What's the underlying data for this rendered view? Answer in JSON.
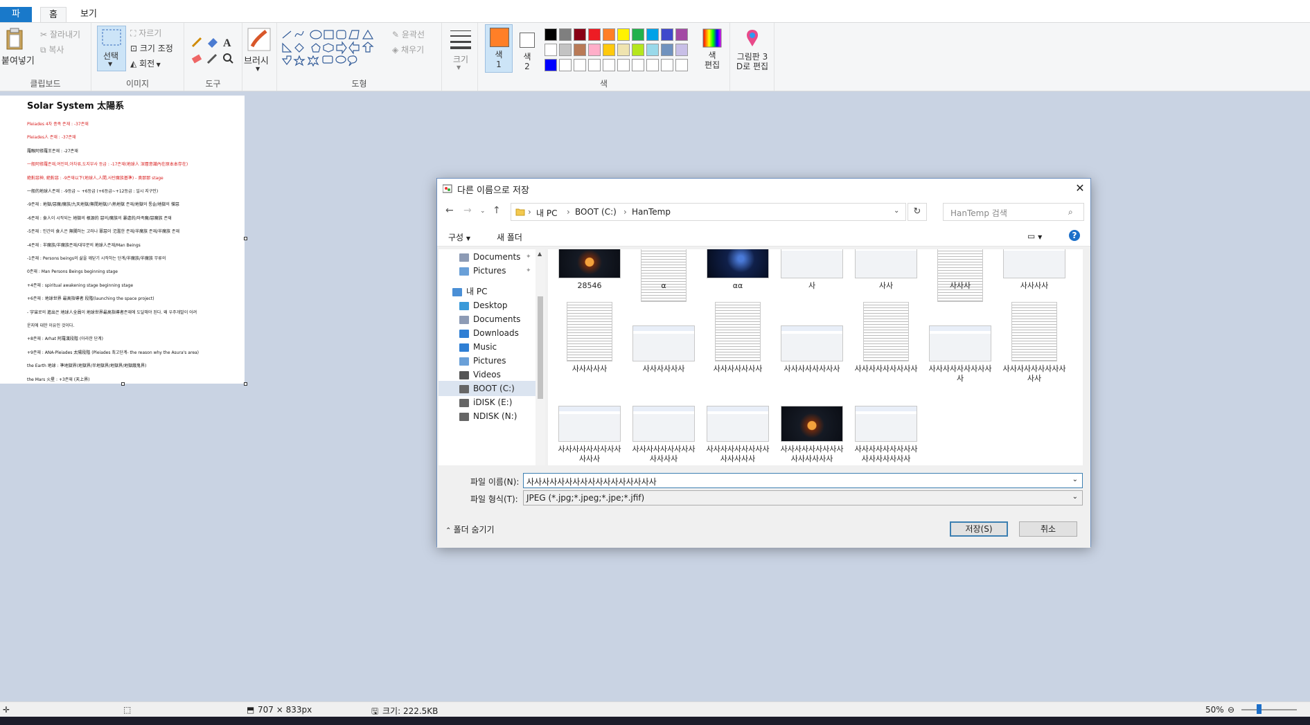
{
  "ribbon": {
    "tabs": [
      "파일",
      "홈",
      "보기"
    ],
    "clipboard": {
      "paste": "붙여넣기",
      "cut": "잘라내기",
      "copy": "복사",
      "label": "클립보드"
    },
    "image": {
      "select": "선택",
      "crop": "자르기",
      "resize": "크기 조정",
      "rotate": "회전",
      "label": "이미지"
    },
    "tools": {
      "label": "도구"
    },
    "brush": {
      "label": "브러시"
    },
    "shapes": {
      "outline": "윤곽선",
      "fill": "채우기",
      "label": "도형"
    },
    "size": {
      "label": "크기"
    },
    "colors": {
      "color1": "색\n1",
      "color2": "색\n2",
      "edit": "색\n편집",
      "label": "색",
      "palette_row1": [
        "#000000",
        "#7f7f7f",
        "#880015",
        "#ed1c24",
        "#ff7f27",
        "#fff200",
        "#22b14c",
        "#00a2e8",
        "#3f48cc",
        "#a349a4"
      ],
      "palette_row2": [
        "#ffffff",
        "#c3c3c3",
        "#b97a57",
        "#ffaec9",
        "#ffc90e",
        "#efe4b0",
        "#b5e61d",
        "#99d9ea",
        "#7092be",
        "#c8bfe7"
      ],
      "palette_row3": [
        "#0000ff",
        "#ffffff",
        "#ffffff",
        "#ffffff",
        "#ffffff",
        "#ffffff",
        "#ffffff",
        "#ffffff",
        "#ffffff",
        "#ffffff"
      ],
      "primary": "#ff7f27",
      "secondary": "#ffffff"
    },
    "paint3d": "그림판 3\nD로 편집"
  },
  "canvas_doc": {
    "title": "Solar System 太陽系",
    "lines": [
      {
        "text": "Pleiades 4차 종족 존재 : -37존재",
        "red": true
      },
      {
        "text": "Pleiades人 존재 : -37존재",
        "red": true
      },
      {
        "text": "羅睺阿修羅王존재 : -27존재",
        "red": false
      },
      {
        "text": "一般阿修羅존재,여인외,야차류,도지부사 등급 : -17존재(地球人 深層意識內在原本本存在)",
        "red": true
      },
      {
        "text": "絶對惡神, 絶對惡 : -9존재以下(地球人,人間,사탄魔族基準) - 奥那那 stage",
        "red": true
      },
      {
        "text": "一般的地球人존재 : -9등급 ~ +6등급 (+6등급~+12등급 : 일시 지구인)",
        "red": false
      },
      {
        "text": "-9존재 : 地獄/惡魔/魔族/九天地獄/無間地獄/八熱地獄 존재/地獄의 통솔/地獄의 憎惡",
        "red": false
      },
      {
        "text": "-6존재 : 食人이 시작되는 地獄의 根源的 惡의/魔族의 暴虐的/마족魔/惡魔族 존재",
        "red": false
      },
      {
        "text": "-5존재 : 인간의 食人은 無關하는 고러나 罪惡이 氾濫한 존재/半魔族 존재/半魔族 존재",
        "red": false
      },
      {
        "text": "-4존재 : 半魔族/半魔族존재/대부분의 地球人존재/Man Beings",
        "red": false
      },
      {
        "text": "-1존재 : Persons beings의 삶을 깨닫기 시작하는 단계/半魔族/半魔族 무류의",
        "red": false
      },
      {
        "text": "0존재 : Man Persons Beings beginning stage",
        "red": false
      },
      {
        "text": "+4존재 : spiritual awakening stage beginning stage",
        "red": false
      },
      {
        "text": "+6존재 : 地球世界 最高指導者 段階(launching the space project)",
        "red": false
      },
      {
        "text": "- 宇宙로의 進出은 地球人全員이 地球世界最高指導者존재에 도달해야 된다. 왜 우주개발이 어려",
        "red": false
      },
      {
        "text": "운지에 대한 이유인 것이다.",
        "red": false
      },
      {
        "text": "+8존재 : Arhat 阿羅漢段階 (아라한 단계)",
        "red": false
      },
      {
        "text": "+9존재 : ANA-Pleiades 太陽段階 (Pleiades 최고단계- the reason why the Asura's area)",
        "red": false
      },
      {
        "text": "the Earth 地球 : 準地獄界(地獄界/半地獄界/地獄界/地獄餓鬼界)",
        "red": false
      },
      {
        "text": "the Mars 火星 : +3존재 (天上界)",
        "red": false
      }
    ]
  },
  "dialog": {
    "title": "다른 이름으로 저장",
    "address": [
      "내 PC",
      "BOOT (C:)",
      "HanTemp"
    ],
    "search_placeholder": "HanTemp 검색",
    "toolbar": {
      "organize": "구성",
      "new_folder": "새 폴더"
    },
    "nav": [
      {
        "label": "Documents",
        "pinned": true,
        "indent": 2,
        "color": "#8d9bb5"
      },
      {
        "label": "Pictures",
        "pinned": true,
        "indent": 2,
        "color": "#6aa0d8"
      },
      {
        "label": "내 PC",
        "pinned": false,
        "indent": 1,
        "color": "#4a8fd6"
      },
      {
        "label": "Desktop",
        "pinned": false,
        "indent": 2,
        "color": "#3a9ad9"
      },
      {
        "label": "Documents",
        "pinned": false,
        "indent": 2,
        "color": "#8d9bb5"
      },
      {
        "label": "Downloads",
        "pinned": false,
        "indent": 2,
        "color": "#2f7fd4"
      },
      {
        "label": "Music",
        "pinned": false,
        "indent": 2,
        "color": "#2f7fd4"
      },
      {
        "label": "Pictures",
        "pinned": false,
        "indent": 2,
        "color": "#6aa0d8"
      },
      {
        "label": "Videos",
        "pinned": false,
        "indent": 2,
        "color": "#555555"
      },
      {
        "label": "BOOT (C:)",
        "pinned": false,
        "indent": 2,
        "color": "#666666",
        "selected": true
      },
      {
        "label": "iDISK (E:)",
        "pinned": false,
        "indent": 2,
        "color": "#666666"
      },
      {
        "label": "NDISK (N:)",
        "pinned": false,
        "indent": 2,
        "color": "#666666"
      }
    ],
    "files": [
      {
        "name": "28546",
        "kind": "solar"
      },
      {
        "name": "α",
        "kind": "doc"
      },
      {
        "name": "αα",
        "kind": "space"
      },
      {
        "name": "사",
        "kind": "window"
      },
      {
        "name": "사사",
        "kind": "window"
      },
      {
        "name": "사사사",
        "kind": "doc"
      },
      {
        "name": "사사사사",
        "kind": "window"
      },
      {
        "name": "사사사사사",
        "kind": "doc"
      },
      {
        "name": "사사사사사사",
        "kind": "window"
      },
      {
        "name": "사사사사사사사",
        "kind": "doc"
      },
      {
        "name": "사사사사사사사사",
        "kind": "window"
      },
      {
        "name": "사사사사사사사사사",
        "kind": "doc"
      },
      {
        "name": "사사사사사사사사사사",
        "kind": "window"
      },
      {
        "name": "사사사사사사사사사사사",
        "kind": "doc"
      },
      {
        "name": "사사사사사사사사사사사사",
        "kind": "window"
      },
      {
        "name": "사사사사사사사사사사사사사",
        "kind": "window"
      },
      {
        "name": "사사사사사사사사사사사사사사",
        "kind": "window"
      },
      {
        "name": "사사사사사사사사사사사사사사사",
        "kind": "solar"
      },
      {
        "name": "사사사사사사사사사사사사사사사사",
        "kind": "window"
      }
    ],
    "filename_label": "파일 이름(N):",
    "filename_value": "사사사사사사사사사사사사사사사사사",
    "filetype_label": "파일 형식(T):",
    "filetype_value": "JPEG (*.jpg;*.jpeg;*.jpe;*.jfif)",
    "hide_folders": "폴더 숨기기",
    "save": "저장(S)",
    "cancel": "취소"
  },
  "status": {
    "dimensions": "707 × 833px",
    "size": "크기: 222.5KB",
    "zoom": "50%"
  }
}
